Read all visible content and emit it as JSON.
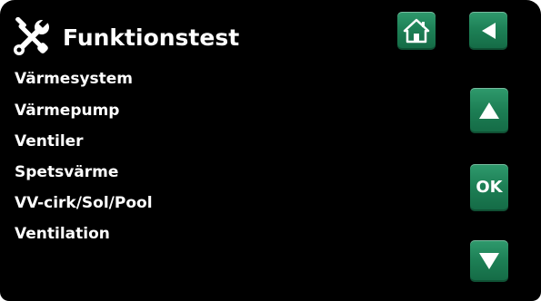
{
  "header": {
    "title": "Funktionstest",
    "title_icon": "tools-icon"
  },
  "menu": {
    "items": [
      {
        "label": "Värmesystem"
      },
      {
        "label": "Värmepump"
      },
      {
        "label": "Ventiler"
      },
      {
        "label": "Spetsvärme"
      },
      {
        "label": "VV-cirk/Sol/Pool"
      },
      {
        "label": "Ventilation"
      }
    ]
  },
  "buttons": {
    "home": {
      "icon": "home-icon"
    },
    "back": {
      "icon": "back-arrow-icon"
    },
    "up": {
      "icon": "up-arrow-icon"
    },
    "ok": {
      "label": "OK"
    },
    "down": {
      "icon": "down-arrow-icon"
    }
  },
  "colors": {
    "background": "#000000",
    "text": "#ffffff",
    "button_green": "#1d7f55"
  }
}
